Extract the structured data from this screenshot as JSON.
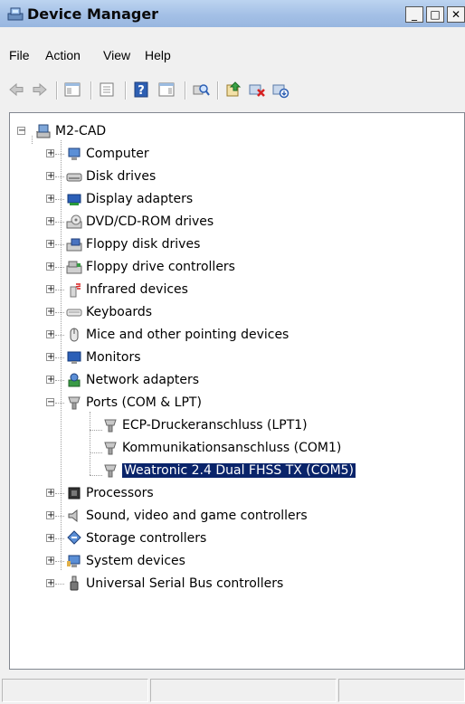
{
  "window": {
    "title": "Device Manager",
    "title_icon": "device-manager-icon"
  },
  "caption_buttons": {
    "minimize": "_",
    "maximize": "□",
    "close": "✕"
  },
  "menu": [
    "File",
    "Action",
    "View",
    "Help"
  ],
  "toolbar": [
    "back-icon",
    "forward-icon",
    "show-hide-console-tree-icon",
    "properties-icon",
    "help-icon",
    "show-hide-action-pane-icon",
    "scan-hardware-icon",
    "update-driver-icon",
    "uninstall-icon",
    "disable-icon"
  ],
  "tree": {
    "root": "M2-CAD",
    "categories": [
      "Computer",
      "Disk drives",
      "Display adapters",
      "DVD/CD-ROM drives",
      "Floppy disk drives",
      "Floppy drive controllers",
      "Infrared devices",
      "Keyboards",
      "Mice and other pointing devices",
      "Monitors",
      "Network adapters",
      "Ports (COM & LPT)",
      "Processors",
      "Sound, video and game controllers",
      "Storage controllers",
      "System devices",
      "Universal Serial Bus controllers"
    ],
    "ports_children": [
      "ECP-Druckeranschluss (LPT1)",
      "Kommunikationsanschluss (COM1)",
      "Weatronic 2.4 Dual FHSS TX (COM5)"
    ],
    "selected": "Weatronic 2.4 Dual FHSS TX (COM5)"
  },
  "colors": {
    "selection": "#0a246a",
    "title_bar": "#a4c0e6"
  }
}
